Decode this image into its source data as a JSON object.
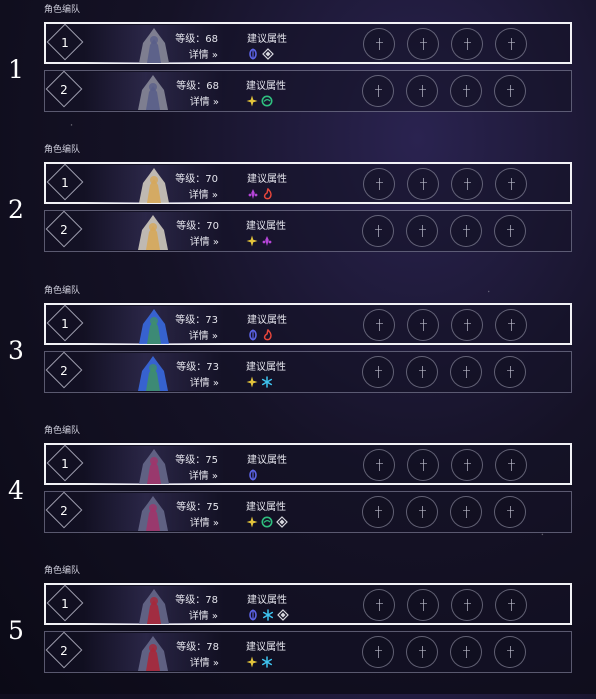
{
  "teams": [
    {
      "number": "1",
      "header": "角色编队",
      "rows": [
        {
          "slot": "1",
          "level": "等级：68",
          "details": "详情",
          "rec_label": "建议属性",
          "elements": [
            "quantum",
            "imaginary"
          ],
          "selected": true
        },
        {
          "slot": "2",
          "level": "等级：68",
          "details": "详情",
          "rec_label": "建议属性",
          "elements": [
            "physical",
            "wind"
          ],
          "selected": false
        }
      ]
    },
    {
      "number": "2",
      "header": "角色编队",
      "rows": [
        {
          "slot": "1",
          "level": "等级：70",
          "details": "详情",
          "rec_label": "建议属性",
          "elements": [
            "lightning",
            "fire"
          ],
          "selected": true
        },
        {
          "slot": "2",
          "level": "等级：70",
          "details": "详情",
          "rec_label": "建议属性",
          "elements": [
            "physical",
            "lightning"
          ],
          "selected": false
        }
      ]
    },
    {
      "number": "3",
      "header": "角色编队",
      "rows": [
        {
          "slot": "1",
          "level": "等级：73",
          "details": "详情",
          "rec_label": "建议属性",
          "elements": [
            "quantum",
            "fire"
          ],
          "selected": true
        },
        {
          "slot": "2",
          "level": "等级：73",
          "details": "详情",
          "rec_label": "建议属性",
          "elements": [
            "physical",
            "ice"
          ],
          "selected": false
        }
      ]
    },
    {
      "number": "4",
      "header": "角色编队",
      "rows": [
        {
          "slot": "1",
          "level": "等级：75",
          "details": "详情",
          "rec_label": "建议属性",
          "elements": [
            "quantum"
          ],
          "selected": true
        },
        {
          "slot": "2",
          "level": "等级：75",
          "details": "详情",
          "rec_label": "建议属性",
          "elements": [
            "physical",
            "wind",
            "imaginary"
          ],
          "selected": false
        }
      ]
    },
    {
      "number": "5",
      "header": "角色编队",
      "rows": [
        {
          "slot": "1",
          "level": "等级：78",
          "details": "详情",
          "rec_label": "建议属性",
          "elements": [
            "quantum",
            "ice",
            "imaginary"
          ],
          "selected": true
        },
        {
          "slot": "2",
          "level": "等级：78",
          "details": "详情",
          "rec_label": "建议属性",
          "elements": [
            "physical",
            "ice"
          ],
          "selected": false
        }
      ]
    }
  ],
  "details_icon": "double-chevron-right-icon",
  "element_colors": {
    "quantum": "#5b63e6",
    "imaginary": "#d8d8de",
    "physical": "#e3c43a",
    "wind": "#2fbf7f",
    "lightning": "#b545d8",
    "fire": "#e8463b",
    "ice": "#3ec4f0"
  },
  "empty_slot_icon": "add-member-icon",
  "empty_slots_per_row": 4
}
